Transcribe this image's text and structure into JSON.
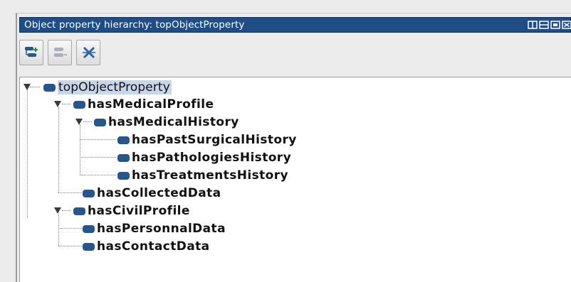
{
  "window": {
    "title": "Object property hierarchy: topObjectProperty"
  },
  "toolbar": {
    "buttons": [
      {
        "icon": "add-sub-property-icon",
        "tooltip": ""
      },
      {
        "icon": "add-sibling-property-icon",
        "tooltip": ""
      },
      {
        "icon": "delete-property-icon",
        "tooltip": ""
      }
    ]
  },
  "tree": {
    "root": "topObjectProperty",
    "nodes": {
      "hasMedicalProfile": "hasMedicalProfile",
      "hasMedicalHistory": "hasMedicalHistory",
      "hasPastSurgicalHistory": "hasPastSurgicalHistory",
      "hasPathologiesHistory": "hasPathologiesHistory",
      "hasTreatmentsHistory": "hasTreatmentsHistory",
      "hasCollectedData": "hasCollectedData",
      "hasCivilProfile": "hasCivilProfile",
      "hasPersonnalData": "hasPersonnalData",
      "hasContactData": "hasContactData"
    }
  },
  "colors": {
    "titlebar": "#1f4d86",
    "property_icon": "#27558e",
    "selection": "#c7d6ea"
  }
}
